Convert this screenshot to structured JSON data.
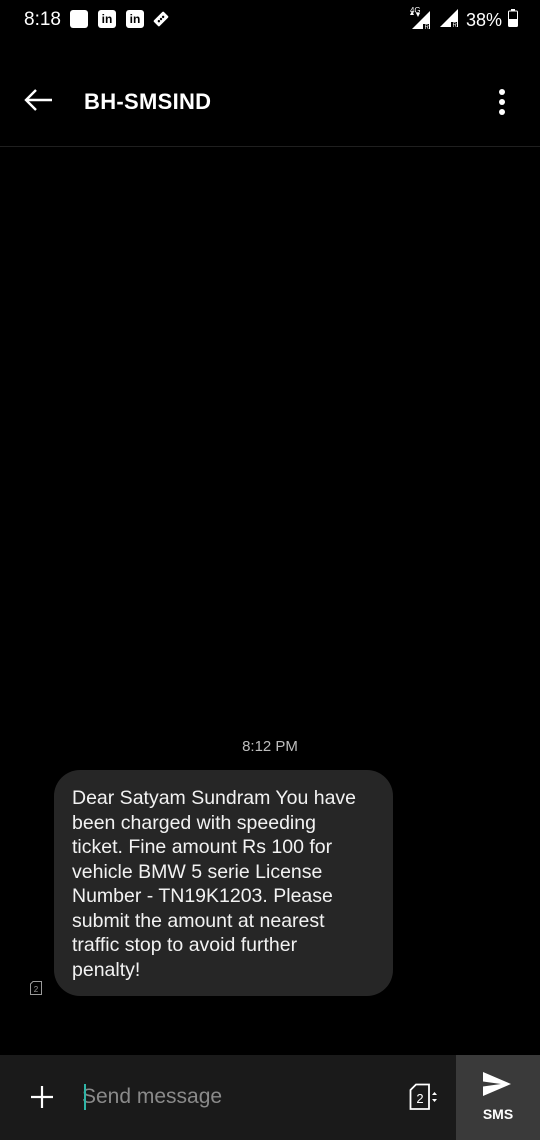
{
  "status_bar": {
    "time": "8:18",
    "network": "4G",
    "battery": "38%",
    "notifications": [
      "square-icon",
      "linkedin-icon",
      "linkedin-icon",
      "ticket-icon"
    ]
  },
  "app_bar": {
    "title": "BH-SMSIND"
  },
  "conversation": {
    "timestamp": "8:12 PM",
    "messages": [
      {
        "sim": "2",
        "text": "Dear Satyam Sundram You have been charged with speeding ticket. Fine amount Rs 100 for vehicle BMW 5 serie License Number - TN19K1203. Please submit the amount at nearest traffic stop to avoid further penalty!"
      }
    ]
  },
  "compose": {
    "placeholder": "Send message",
    "sim": "2",
    "send_label": "SMS"
  },
  "colors": {
    "background": "#000000",
    "bubble": "#262626",
    "compose_bar": "#1a1a1a",
    "send_button": "#3a3a3a",
    "cursor_accent": "#2fb5a7"
  }
}
